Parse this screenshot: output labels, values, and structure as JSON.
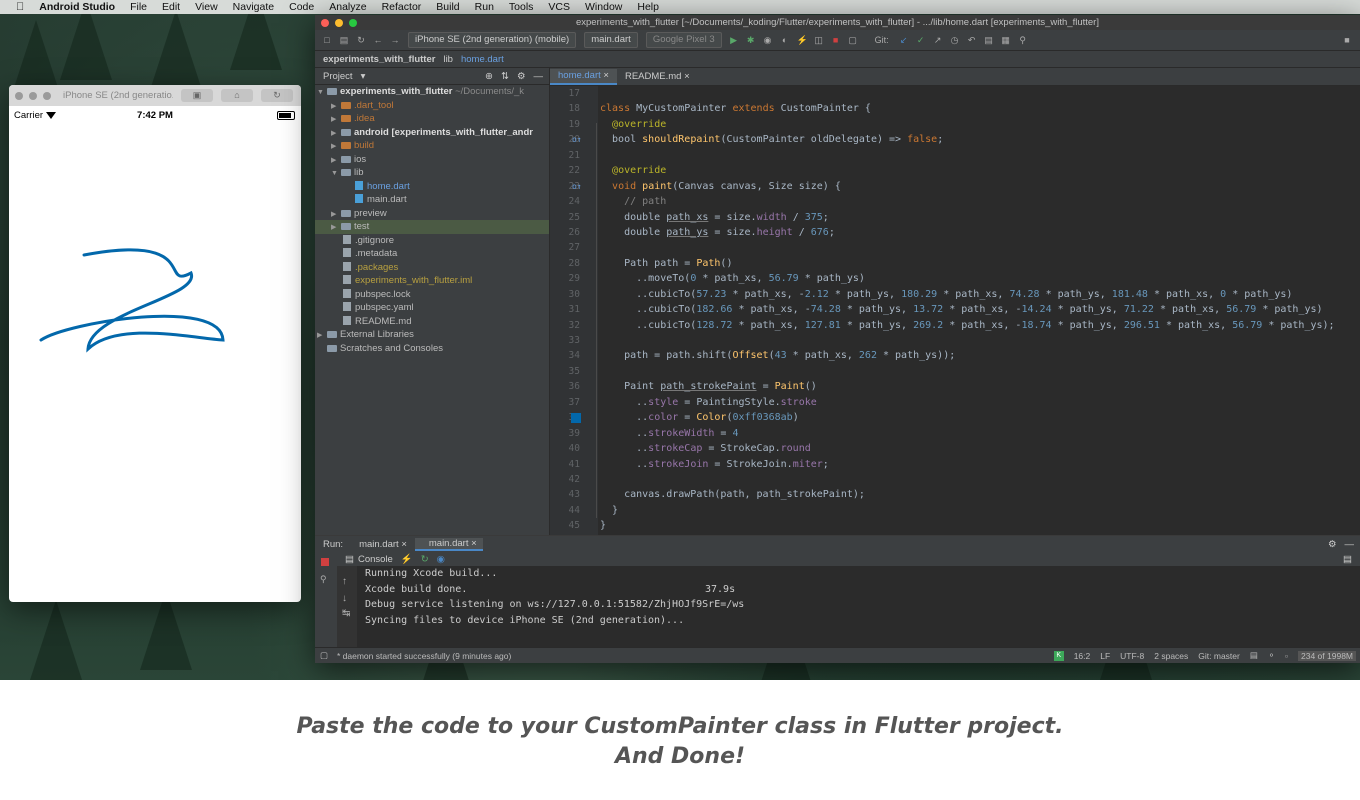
{
  "menubar": {
    "app": "Android Studio",
    "items": [
      "File",
      "Edit",
      "View",
      "Navigate",
      "Code",
      "Analyze",
      "Refactor",
      "Build",
      "Run",
      "Tools",
      "VCS",
      "Window",
      "Help"
    ]
  },
  "simulator": {
    "title": "iPhone SE (2nd generatio...",
    "carrier": "Carrier",
    "time": "7:42 PM"
  },
  "ide": {
    "title": "experiments_with_flutter [~/Documents/_koding/Flutter/experiments_with_flutter] - .../lib/home.dart [experiments_with_flutter]",
    "device_combo": "iPhone SE (2nd generation) (mobile)",
    "run_config": "main.dart",
    "emulator_combo": "Google Pixel 3",
    "git_label": "Git:",
    "breadcrumb": [
      "experiments_with_flutter",
      "lib",
      "home.dart"
    ],
    "project_label": "Project",
    "tree": [
      {
        "label": "experiments_with_flutter",
        "suffix": "~/Documents/_k"
      },
      {
        "label": ".dart_tool"
      },
      {
        "label": ".idea"
      },
      {
        "label": "android",
        "suffix": "[experiments_with_flutter_andr"
      },
      {
        "label": "build"
      },
      {
        "label": "ios"
      },
      {
        "label": "lib"
      },
      {
        "label": "home.dart"
      },
      {
        "label": "main.dart"
      },
      {
        "label": "preview"
      },
      {
        "label": "test"
      },
      {
        "label": ".gitignore"
      },
      {
        "label": ".metadata"
      },
      {
        "label": ".packages"
      },
      {
        "label": "experiments_with_flutter.iml"
      },
      {
        "label": "pubspec.lock"
      },
      {
        "label": "pubspec.yaml"
      },
      {
        "label": "README.md"
      },
      {
        "label": "External Libraries"
      },
      {
        "label": "Scratches and Consoles"
      }
    ],
    "tabs": [
      "home.dart",
      "README.md"
    ],
    "line_numbers": [
      "17",
      "18",
      "19",
      "20",
      "21",
      "22",
      "23",
      "24",
      "25",
      "26",
      "27",
      "28",
      "29",
      "30",
      "31",
      "32",
      "33",
      "34",
      "35",
      "36",
      "37",
      "38",
      "39",
      "40",
      "41",
      "42",
      "43",
      "44",
      "45"
    ],
    "run": {
      "label": "Run:",
      "tabs": [
        "main.dart",
        "main.dart"
      ],
      "console_tab": "Console",
      "console_lines": [
        "Running Xcode build...",
        "Xcode build done.",
        "Debug service listening on ws://127.0.0.1:51582/ZhjHOJf9SrE=/ws",
        "Syncing files to device iPhone SE (2nd generation)..."
      ],
      "duration": "37.9s"
    },
    "status": {
      "message": "* daemon started successfully (9 minutes ago)",
      "position": "16:2",
      "line_sep": "LF",
      "encoding": "UTF-8",
      "indent": "2 spaces",
      "git": "Git: master",
      "memory": "234 of 1998M"
    }
  },
  "caption": {
    "line1": "Paste  the code to your CustomPainter class in Flutter project.",
    "line2": "And Done!"
  },
  "colors": {
    "stroke": "#0368ab",
    "accent": "#4a88c7"
  }
}
